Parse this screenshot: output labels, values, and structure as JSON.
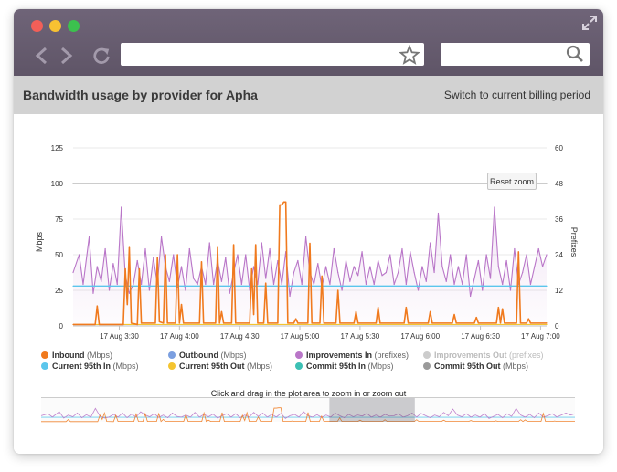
{
  "browser": {
    "url_value": "",
    "search_value": ""
  },
  "header": {
    "title": "Bandwidth usage by provider for Apha",
    "switch_link": "Switch to current billing period"
  },
  "chart": {
    "reset_zoom_label": "Reset zoom",
    "navigator_caption": "Click and drag in the plot area to zoom in or zoom out"
  },
  "legend": [
    {
      "name": "Inbound",
      "unit": "(Mbps)",
      "color": "#f07a1e",
      "hidden": false
    },
    {
      "name": "Outbound",
      "unit": "(Mbps)",
      "color": "#7b9fe0",
      "hidden": false
    },
    {
      "name": "Improvements In",
      "unit": "(prefixes)",
      "color": "#b976c8",
      "hidden": false
    },
    {
      "name": "Improvements Out",
      "unit": "(prefixes)",
      "color": "#cccccc",
      "hidden": true
    },
    {
      "name": "Current 95th In",
      "unit": "(Mbps)",
      "color": "#5bc6ec",
      "hidden": false
    },
    {
      "name": "Current 95th Out",
      "unit": "(Mbps)",
      "color": "#f4c430",
      "hidden": false
    },
    {
      "name": "Commit 95th In",
      "unit": "(Mbps)",
      "color": "#3cc0b4",
      "hidden": false
    },
    {
      "name": "Commit 95th Out",
      "unit": "(Mbps)",
      "color": "#9a9a9a",
      "hidden": false
    }
  ],
  "chart_data": {
    "type": "line",
    "title": "",
    "ylabel": "Mbps",
    "y2label": "Prefixes",
    "ylim": [
      0,
      125
    ],
    "y2lim": [
      0,
      60
    ],
    "yticks": [
      "0",
      "25",
      "50",
      "75",
      "100",
      "125"
    ],
    "y2ticks": [
      "0",
      "12",
      "24",
      "36",
      "48",
      "60"
    ],
    "xticks": [
      "17 Aug 3:30",
      "17 Aug 4:00",
      "17 Aug 4:30",
      "17 Aug 5:00",
      "17 Aug 5:30",
      "17 Aug 6:00",
      "17 Aug 6:30",
      "17 Aug 7:00"
    ],
    "x_range_minutes": [
      187,
      423
    ],
    "grid": true,
    "series": [
      {
        "name": "Inbound",
        "unit": "Mbps",
        "color": "#f07a1e",
        "points": [
          [
            187,
            1
          ],
          [
            198,
            1
          ],
          [
            199,
            14
          ],
          [
            200,
            1
          ],
          [
            212,
            1
          ],
          [
            213,
            40
          ],
          [
            214,
            15
          ],
          [
            215,
            55
          ],
          [
            216,
            2
          ],
          [
            219,
            1
          ],
          [
            220,
            40
          ],
          [
            221,
            2
          ],
          [
            228,
            2
          ],
          [
            229,
            48
          ],
          [
            230,
            3
          ],
          [
            232,
            2
          ],
          [
            233,
            50
          ],
          [
            234,
            2
          ],
          [
            238,
            2
          ],
          [
            239,
            50
          ],
          [
            240,
            2
          ],
          [
            241,
            15
          ],
          [
            242,
            2
          ],
          [
            250,
            2
          ],
          [
            251,
            45
          ],
          [
            252,
            2
          ],
          [
            258,
            2
          ],
          [
            259,
            55
          ],
          [
            260,
            2
          ],
          [
            261,
            10
          ],
          [
            262,
            2
          ],
          [
            266,
            2
          ],
          [
            267,
            57
          ],
          [
            268,
            2
          ],
          [
            275,
            2
          ],
          [
            276,
            40
          ],
          [
            277,
            8
          ],
          [
            278,
            57
          ],
          [
            279,
            2
          ],
          [
            282,
            2
          ],
          [
            283,
            30
          ],
          [
            284,
            2
          ],
          [
            289,
            2
          ],
          [
            290,
            85
          ],
          [
            291,
            85
          ],
          [
            292,
            87
          ],
          [
            293,
            87
          ],
          [
            294,
            2
          ],
          [
            297,
            2
          ],
          [
            298,
            5
          ],
          [
            299,
            2
          ],
          [
            304,
            2
          ],
          [
            305,
            58
          ],
          [
            306,
            2
          ],
          [
            310,
            2
          ],
          [
            311,
            35
          ],
          [
            312,
            2
          ],
          [
            318,
            2
          ],
          [
            319,
            25
          ],
          [
            320,
            2
          ],
          [
            327,
            2
          ],
          [
            328,
            10
          ],
          [
            329,
            2
          ],
          [
            338,
            2
          ],
          [
            339,
            13
          ],
          [
            340,
            2
          ],
          [
            352,
            2
          ],
          [
            353,
            13
          ],
          [
            354,
            2
          ],
          [
            364,
            2
          ],
          [
            365,
            10
          ],
          [
            366,
            2
          ],
          [
            376,
            2
          ],
          [
            377,
            8
          ],
          [
            378,
            2
          ],
          [
            387,
            2
          ],
          [
            388,
            6
          ],
          [
            389,
            2
          ],
          [
            398,
            2
          ],
          [
            399,
            13
          ],
          [
            400,
            2
          ],
          [
            401,
            12
          ],
          [
            402,
            2
          ],
          [
            408,
            2
          ],
          [
            409,
            52
          ],
          [
            410,
            2
          ],
          [
            413,
            2
          ],
          [
            414,
            5
          ],
          [
            415,
            2
          ],
          [
            423,
            2
          ]
        ]
      },
      {
        "name": "Improvements In",
        "unit": "prefixes",
        "color": "#b976c8",
        "points": [
          [
            187,
            18
          ],
          [
            190,
            24
          ],
          [
            192,
            14
          ],
          [
            195,
            30
          ],
          [
            197,
            11
          ],
          [
            199,
            20
          ],
          [
            201,
            15
          ],
          [
            203,
            26
          ],
          [
            205,
            12
          ],
          [
            207,
            21
          ],
          [
            209,
            14
          ],
          [
            211,
            40
          ],
          [
            213,
            17
          ],
          [
            215,
            11
          ],
          [
            217,
            14
          ],
          [
            219,
            22
          ],
          [
            221,
            14
          ],
          [
            223,
            26
          ],
          [
            225,
            12
          ],
          [
            227,
            23
          ],
          [
            229,
            14
          ],
          [
            231,
            30
          ],
          [
            233,
            20
          ],
          [
            235,
            15
          ],
          [
            237,
            24
          ],
          [
            239,
            13
          ],
          [
            241,
            20
          ],
          [
            243,
            12
          ],
          [
            245,
            26
          ],
          [
            247,
            16
          ],
          [
            249,
            14
          ],
          [
            251,
            20
          ],
          [
            253,
            14
          ],
          [
            255,
            28
          ],
          [
            257,
            14
          ],
          [
            259,
            22
          ],
          [
            261,
            15
          ],
          [
            263,
            23
          ],
          [
            265,
            11
          ],
          [
            267,
            18
          ],
          [
            269,
            24
          ],
          [
            271,
            14
          ],
          [
            273,
            24
          ],
          [
            275,
            12
          ],
          [
            277,
            20
          ],
          [
            279,
            14
          ],
          [
            281,
            28
          ],
          [
            283,
            16
          ],
          [
            285,
            26
          ],
          [
            287,
            14
          ],
          [
            289,
            22
          ],
          [
            291,
            14
          ],
          [
            293,
            25
          ],
          [
            295,
            10
          ],
          [
            297,
            18
          ],
          [
            299,
            22
          ],
          [
            301,
            14
          ],
          [
            303,
            30
          ],
          [
            305,
            18
          ],
          [
            307,
            14
          ],
          [
            309,
            21
          ],
          [
            311,
            13
          ],
          [
            313,
            20
          ],
          [
            315,
            14
          ],
          [
            317,
            26
          ],
          [
            319,
            18
          ],
          [
            321,
            12
          ],
          [
            323,
            22
          ],
          [
            325,
            15
          ],
          [
            327,
            20
          ],
          [
            329,
            17
          ],
          [
            331,
            25
          ],
          [
            333,
            14
          ],
          [
            335,
            20
          ],
          [
            337,
            14
          ],
          [
            339,
            22
          ],
          [
            341,
            17
          ],
          [
            343,
            18
          ],
          [
            345,
            24
          ],
          [
            347,
            14
          ],
          [
            349,
            18
          ],
          [
            351,
            26
          ],
          [
            353,
            14
          ],
          [
            355,
            25
          ],
          [
            357,
            18
          ],
          [
            359,
            12
          ],
          [
            361,
            20
          ],
          [
            363,
            15
          ],
          [
            365,
            28
          ],
          [
            367,
            18
          ],
          [
            369,
            38
          ],
          [
            371,
            20
          ],
          [
            373,
            15
          ],
          [
            375,
            24
          ],
          [
            377,
            14
          ],
          [
            379,
            20
          ],
          [
            381,
            14
          ],
          [
            383,
            24
          ],
          [
            385,
            10
          ],
          [
            387,
            16
          ],
          [
            389,
            22
          ],
          [
            391,
            12
          ],
          [
            393,
            24
          ],
          [
            395,
            16
          ],
          [
            397,
            40
          ],
          [
            399,
            20
          ],
          [
            401,
            14
          ],
          [
            403,
            22
          ],
          [
            405,
            12
          ],
          [
            407,
            26
          ],
          [
            409,
            14
          ],
          [
            411,
            18
          ],
          [
            413,
            24
          ],
          [
            415,
            14
          ],
          [
            417,
            20
          ],
          [
            419,
            26
          ],
          [
            421,
            20
          ],
          [
            423,
            24
          ]
        ]
      },
      {
        "name": "Current 95th In",
        "unit": "Mbps",
        "color": "#5bc6ec",
        "points": [
          [
            187,
            28
          ],
          [
            423,
            28
          ]
        ]
      },
      {
        "name": "Current 95th Out",
        "unit": "Mbps",
        "color": "#f4c430",
        "points": [
          [
            187,
            1
          ],
          [
            423,
            1
          ]
        ]
      },
      {
        "name": "Commit 95th Out",
        "unit": "Mbps",
        "color": "#9a9a9a",
        "points": [
          [
            187,
            100
          ],
          [
            423,
            100
          ]
        ]
      }
    ],
    "navigator": {
      "selected_range_fraction": [
        0.54,
        0.7
      ]
    }
  }
}
